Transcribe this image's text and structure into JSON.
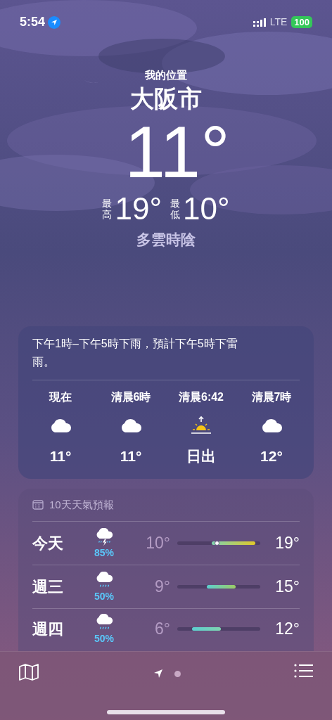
{
  "status_bar": {
    "time": "5:54",
    "network": "LTE",
    "battery": "100"
  },
  "header": {
    "label": "我的位置",
    "city": "大阪市",
    "temperature": "11°",
    "high_label": "最高",
    "high": "19°",
    "low_label": "最低",
    "low": "10°",
    "condition": "多雲時陰"
  },
  "hourly_card": {
    "summary": "下午1時–下午5時下雨，預計下午5時下雷雨。",
    "hours": [
      {
        "time": "現在",
        "kind": "cloud",
        "value": "11°"
      },
      {
        "time": "清晨6時",
        "kind": "cloud",
        "value": "11°"
      },
      {
        "time": "清晨6:42",
        "kind": "sunrise",
        "value": "日出"
      },
      {
        "time": "清晨7時",
        "kind": "cloud",
        "value": "12°"
      }
    ]
  },
  "daily_card": {
    "title": "10天天氣預報",
    "days": [
      {
        "day": "今天",
        "kind": "thunderstorm",
        "chance": "85%",
        "low": "10°",
        "high": "19°",
        "current": true
      },
      {
        "day": "週三",
        "kind": "rain",
        "chance": "50%",
        "low": "9°",
        "high": "15°",
        "current": false
      },
      {
        "day": "週四",
        "kind": "rain",
        "chance": "50%",
        "low": "6°",
        "high": "12°",
        "current": false
      }
    ]
  },
  "page_dots": [
    {
      "kind": "location",
      "selected": true
    },
    {
      "kind": "dot",
      "selected": false
    }
  ]
}
